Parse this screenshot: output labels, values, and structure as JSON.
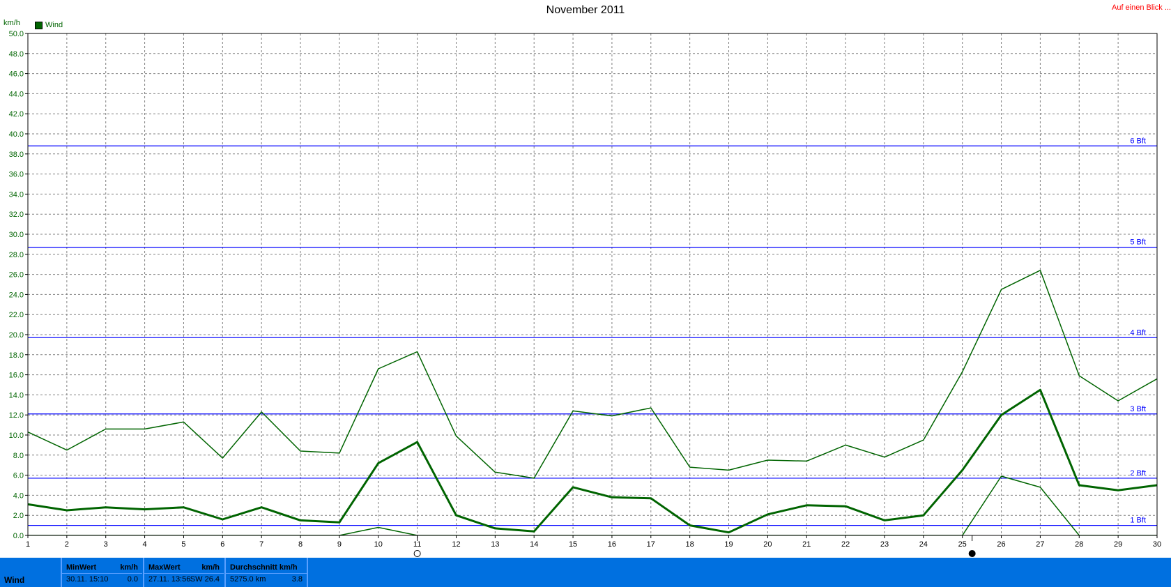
{
  "header": {
    "title": "November 2011",
    "link": "Auf einen Blick ...",
    "y_unit": "km/h",
    "legend_label": "Wind"
  },
  "colors": {
    "series": "#006400",
    "beaufort": "#0000ff",
    "link": "#ff0000",
    "info_bar": "#0070e0"
  },
  "chart_data": {
    "type": "line",
    "title": "November 2011",
    "ylabel": "km/h",
    "ylim": [
      0,
      50
    ],
    "y_ticks": [
      "0.0",
      "2.0",
      "4.0",
      "6.0",
      "8.0",
      "10.0",
      "12.0",
      "14.0",
      "16.0",
      "18.0",
      "20.0",
      "22.0",
      "24.0",
      "26.0",
      "28.0",
      "30.0",
      "32.0",
      "34.0",
      "36.0",
      "38.0",
      "40.0",
      "42.0",
      "44.0",
      "46.0",
      "48.0",
      "50.0"
    ],
    "x": [
      1,
      2,
      3,
      4,
      5,
      6,
      7,
      8,
      9,
      10,
      11,
      12,
      13,
      14,
      15,
      16,
      17,
      18,
      19,
      20,
      21,
      22,
      23,
      24,
      25,
      26,
      27,
      28,
      29,
      30
    ],
    "xlim": [
      1,
      30
    ],
    "grid": true,
    "legend": "top-left",
    "series": [
      {
        "name": "Wind",
        "role": "max",
        "width": 1.5,
        "values": [
          10.3,
          8.5,
          10.6,
          10.6,
          11.3,
          7.7,
          12.3,
          8.4,
          8.2,
          16.6,
          18.3,
          9.9,
          6.3,
          5.7,
          12.4,
          11.9,
          12.7,
          6.8,
          6.5,
          7.5,
          7.4,
          9.0,
          7.8,
          9.5,
          16.3,
          24.5,
          26.4,
          15.9,
          13.4,
          15.6
        ]
      },
      {
        "name": "Wind",
        "role": "avg",
        "width": 3,
        "values": [
          3.1,
          2.5,
          2.8,
          2.6,
          2.8,
          1.6,
          2.8,
          1.5,
          1.3,
          7.2,
          9.3,
          2.0,
          0.7,
          0.4,
          4.8,
          3.8,
          3.7,
          1.0,
          0.3,
          2.1,
          3.0,
          2.9,
          1.5,
          2.0,
          6.5,
          12.0,
          14.5,
          5.0,
          4.5,
          5.0
        ]
      },
      {
        "name": "Wind",
        "role": "min",
        "width": 1.5,
        "values": [
          0,
          0,
          0,
          0,
          0,
          0,
          0,
          0,
          0,
          0.8,
          0,
          0,
          0,
          0,
          0,
          0,
          0,
          0,
          0,
          0,
          0,
          0,
          0,
          0,
          0,
          5.9,
          4.8,
          0,
          0,
          0
        ]
      }
    ],
    "reference_lines": [
      {
        "label": "1 Bft",
        "value": 1.0
      },
      {
        "label": "2 Bft",
        "value": 5.7
      },
      {
        "label": "3 Bft",
        "value": 12.1
      },
      {
        "label": "4 Bft",
        "value": 19.7
      },
      {
        "label": "5 Bft",
        "value": 28.7
      },
      {
        "label": "6 Bft",
        "value": 38.8
      }
    ],
    "markers": [
      {
        "x": 11,
        "symbol": "open-circle"
      },
      {
        "x": 25.25,
        "symbol": "filled-circle"
      }
    ]
  },
  "info": {
    "row_label": "Wind",
    "min": {
      "header": "MinWert",
      "unit": "km/h",
      "time": "30.11.  15:10",
      "value": "0.0"
    },
    "max": {
      "header": "MaxWert",
      "unit": "km/h",
      "time": "27.11.  13:56",
      "dir": "SW",
      "value": "26.4"
    },
    "avg": {
      "header": "Durchschnitt km/h",
      "distance": "5275.0 km",
      "value": "3.8"
    }
  }
}
